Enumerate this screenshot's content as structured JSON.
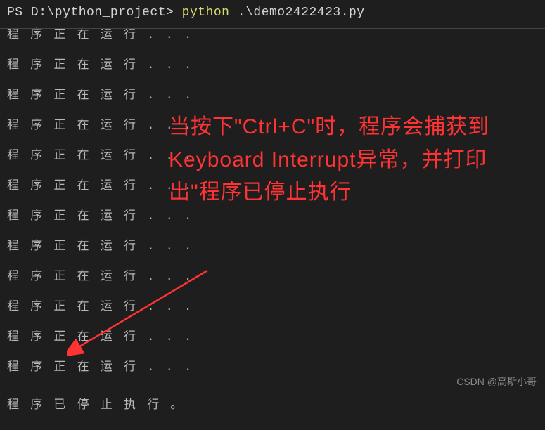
{
  "prompt": {
    "ps": "PS ",
    "path": "D:\\python_project>",
    "command": " python",
    "arg": " .\\demo2422423.py"
  },
  "output": {
    "running": "程 序 正 在 运 行 . . .",
    "stopped": "程 序 已 停 止 执 行 。"
  },
  "running_count": 12,
  "annotation": {
    "text": "当按下\"Ctrl+C\"时，程序会捕获到Keyboard Interrupt异常，并打印出\"程序已停止执行"
  },
  "watermark": "CSDN @高斯小哥"
}
